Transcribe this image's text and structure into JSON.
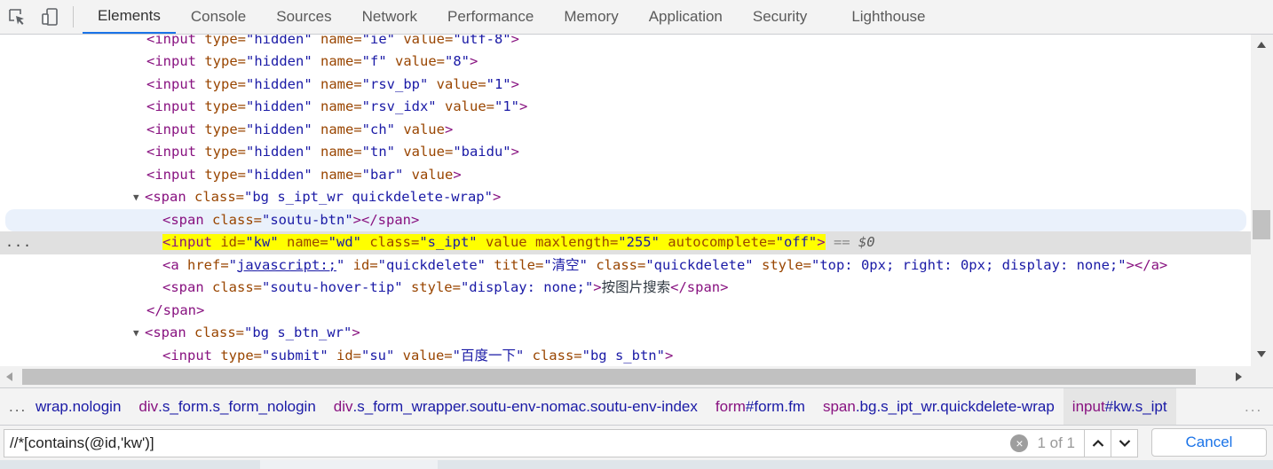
{
  "tabs": [
    {
      "label": "Elements",
      "active": true
    },
    {
      "label": "Console"
    },
    {
      "label": "Sources"
    },
    {
      "label": "Network"
    },
    {
      "label": "Performance"
    },
    {
      "label": "Memory"
    },
    {
      "label": "Application"
    },
    {
      "label": "Security"
    },
    {
      "label": "Lighthouse"
    }
  ],
  "tree": {
    "l0": {
      "tag": "<input",
      "a1": " type=",
      "v1": "\"hidden\"",
      "a2": " name=",
      "v2": "\"ie\"",
      "a3": " value=",
      "v3": "\"utf-8\"",
      "end": ">"
    },
    "l1": {
      "tag": "<input",
      "a1": " type=",
      "v1": "\"hidden\"",
      "a2": " name=",
      "v2": "\"f\"",
      "a3": " value=",
      "v3": "\"8\"",
      "end": ">"
    },
    "l2": {
      "tag": "<input",
      "a1": " type=",
      "v1": "\"hidden\"",
      "a2": " name=",
      "v2": "\"rsv_bp\"",
      "a3": " value=",
      "v3": "\"1\"",
      "end": ">"
    },
    "l3": {
      "tag": "<input",
      "a1": " type=",
      "v1": "\"hidden\"",
      "a2": " name=",
      "v2": "\"rsv_idx\"",
      "a3": " value=",
      "v3": "\"1\"",
      "end": ">"
    },
    "l4": {
      "tag": "<input",
      "a1": " type=",
      "v1": "\"hidden\"",
      "a2": " name=",
      "v2": "\"ch\"",
      "a3": " value",
      "end": ">"
    },
    "l5": {
      "tag": "<input",
      "a1": " type=",
      "v1": "\"hidden\"",
      "a2": " name=",
      "v2": "\"tn\"",
      "a3": " value=",
      "v3": "\"baidu\"",
      "end": ">"
    },
    "l6": {
      "tag": "<input",
      "a1": " type=",
      "v1": "\"hidden\"",
      "a2": " name=",
      "v2": "\"bar\"",
      "a3": " value",
      "end": ">"
    },
    "l7": {
      "triangle": "▼",
      "tag": "<span",
      "a1": " class=",
      "v1": "\"bg s_ipt_wr quickdelete-wrap\"",
      "end": ">"
    },
    "l8": {
      "tag": "<span",
      "a1": " class=",
      "v1": "\"soutu-btn\"",
      "end": "></span>"
    },
    "l9": {
      "dots": "...",
      "tag": "<input",
      "a1": " id=",
      "v1": "\"kw\"",
      "a2": " name=",
      "v2": "\"wd\"",
      "a3": " class=",
      "v3": "\"s_ipt\"",
      "a4": " value maxlength=",
      "v4": "\"255\"",
      "a5": " autocomplete=",
      "v5": "\"off\"",
      "end": ">",
      "eq": " == ",
      "ref": "$0"
    },
    "l10": {
      "tag": "<a",
      "a1": " href=",
      "q": "\"",
      "link": "javascript:;",
      "q2": "\"",
      "a2": " id=",
      "v2": "\"quickdelete\"",
      "a3": " title=",
      "v3": "\"清空\"",
      "a4": " class=",
      "v4": "\"quickdelete\"",
      "a5": " style=",
      "v5": "\"top: 0px; right: 0px; display: none;\"",
      "end": "></a>"
    },
    "l11": {
      "tag": "<span",
      "a1": " class=",
      "v1": "\"soutu-hover-tip\"",
      "a2": " style=",
      "v2": "\"display: none;\"",
      "mid": ">",
      "text": "按图片搜索",
      "end": "</span>"
    },
    "l12": {
      "tag": "</span>"
    },
    "l13": {
      "triangle": "▼",
      "tag": "<span",
      "a1": " class=",
      "v1": "\"bg s_btn_wr\"",
      "end": ">"
    },
    "l14": {
      "tag": "<input",
      "a1": " type=",
      "v1": "\"submit\"",
      "a2": " id=",
      "v2": "\"su\"",
      "a3": " value=",
      "v3": "\"百度一下\"",
      "a4": " class=",
      "v4": "\"bg s_btn\"",
      "end": ">"
    }
  },
  "breadcrumbs": {
    "more": "...",
    "items": [
      {
        "tag": "",
        "rest": "wrap.nologin"
      },
      {
        "tag": "div",
        "rest": ".s_form.s_form_nologin"
      },
      {
        "tag": "div",
        "rest": ".s_form_wrapper.soutu-env-nomac.soutu-env-index"
      },
      {
        "tag": "form",
        "rest": "#form.fm"
      },
      {
        "tag": "span",
        "rest": ".bg.s_ipt_wr.quickdelete-wrap"
      },
      {
        "tag": "input",
        "rest": "#kw.s_ipt"
      }
    ],
    "overflow": "..."
  },
  "search": {
    "value": "//*[contains(@id,'kw')]",
    "match_count": "1 of 1",
    "cancel_label": "Cancel"
  },
  "icons": {
    "inspect": "inspect-element-icon",
    "device": "device-toolbar-icon",
    "clear": "clear-search-icon",
    "prev": "chevron-up-icon",
    "next": "chevron-down-icon"
  },
  "colors": {
    "accent": "#1a73e8",
    "tag": "#881280",
    "attr": "#994500",
    "value": "#1a1aa6",
    "highlight": "#ffff00"
  }
}
